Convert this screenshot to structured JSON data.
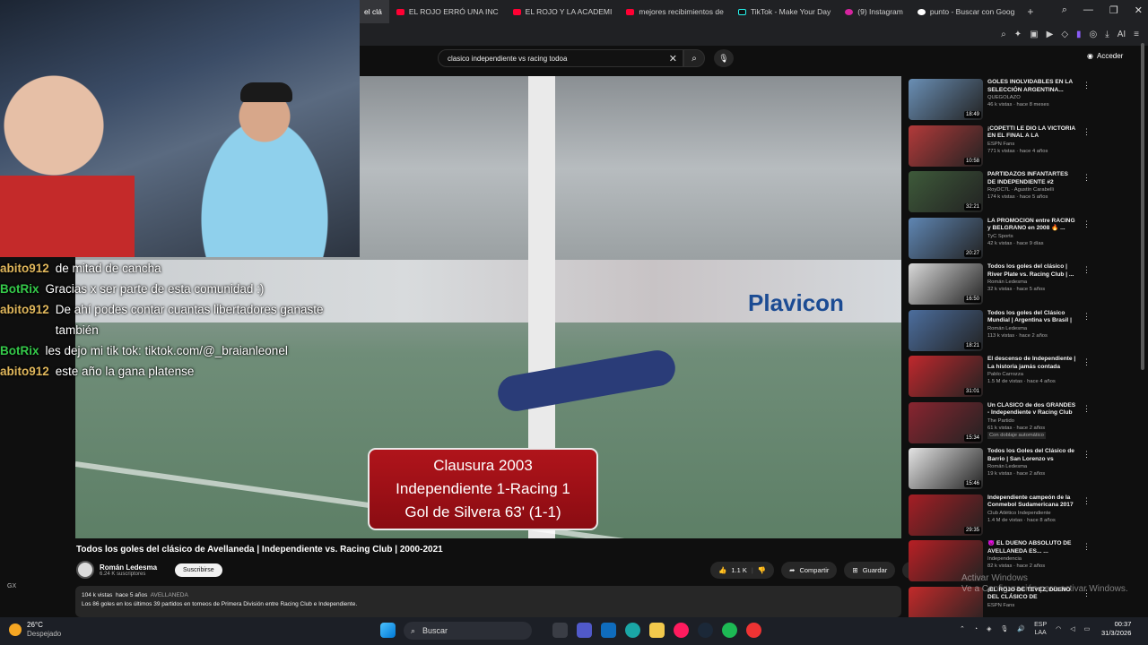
{
  "browser": {
    "tabs": [
      {
        "label": "el clá",
        "active": true
      },
      {
        "label": "EL ROJO ERRÓ UNA INC",
        "active": false
      },
      {
        "label": "EL ROJO Y LA ACADEMI",
        "active": false
      },
      {
        "label": "mejores recibimientos de",
        "active": false
      },
      {
        "label": "TikTok - Make Your Day",
        "active": false
      },
      {
        "label": "(9) Instagram",
        "active": false
      },
      {
        "label": "punto - Buscar con Goog",
        "active": false
      }
    ],
    "toolbar_ai": "AI"
  },
  "youtube": {
    "search_value": "clasico independiente vs racing todoa",
    "signin_label": "Acceder",
    "video": {
      "title": "Todos los goles del clásico de Avellaneda | Independiente vs. Racing Club | 2000-2021",
      "overlay_lines": [
        "Clausura 2003",
        "Independiente 1-Racing 1",
        "Gol de Silvera 63' (1-1)"
      ],
      "banner_text": "Plavicon",
      "channel": "Román Ledesma",
      "subscribers": "6.24 K suscriptores",
      "subscribe_label": "Suscribirse",
      "likes": "1.1 K",
      "share_label": "Compartir",
      "save_label": "Guardar",
      "views": "104 k vistas",
      "age": "hace 5 años",
      "tag": "AVELLANEDA",
      "description": "Los 86 goles en los últimos 39 partidos en torneos de Primera División entre Racing Club e Independiente."
    },
    "recommendations": [
      {
        "title": "GOLES INOLVIDABLES EN LA SELECCIÓN ARGENTINA...",
        "channel": "QUEGOLAZO",
        "meta": "46 k vistas · hace 8 meses",
        "duration": "18:49",
        "color": "#6a8fb5"
      },
      {
        "title": "¡COPETTI LE DIO LA VICTORIA EN EL FINAL A LA ACADEMIA!...",
        "channel": "ESPN Fans",
        "meta": "771 k vistas · hace 4 años",
        "duration": "10:58",
        "color": "#b33a3a"
      },
      {
        "title": "PARTIDAZOS INFANTARTES DE INDEPENDIENTE #2",
        "channel": "RoyDC7L · Agustín Carabelli",
        "meta": "174 k vistas · hace 5 años",
        "duration": "32:21",
        "color": "#3e5a3a"
      },
      {
        "title": "LA PROMOCIÓN entre RACING y BELGRANO en 2008 🔥 ...",
        "channel": "TyC Sports",
        "meta": "42 k vistas · hace 9 días",
        "duration": "20:27",
        "color": "#5f86b3"
      },
      {
        "title": "Todos los goles del clásico | River Plate vs. Racing Club | ...",
        "channel": "Román Ledesma",
        "meta": "32 k vistas · hace 5 años",
        "duration": "16:50",
        "color": "#d9d9d9"
      },
      {
        "title": "Todos los goles del Clásico Mundial | Argentina vs Brasil | ...",
        "channel": "Román Ledesma",
        "meta": "113 k vistas · hace 2 años",
        "duration": "18:21",
        "color": "#4c6e9e"
      },
      {
        "title": "El descenso de Independiente | La historia jamás contada",
        "channel": "Pablo Carrozza",
        "meta": "1.5 M de vistas · hace 4 años",
        "duration": "31:01",
        "color": "#c0282d"
      },
      {
        "title": "Un CLÁSICO de dos GRANDES - Independiente v Racing Club",
        "channel": "The Partido",
        "meta": "61 k vistas · hace 2 años",
        "duration": "15:34",
        "extra": "Con doblaje automático",
        "color": "#8a2530"
      },
      {
        "title": "Todos los Goles del Clásico de Barrio | San Lorenzo vs Huracá...",
        "channel": "Román Ledesma",
        "meta": "19 k vistas · hace 2 años",
        "duration": "15:46",
        "color": "#e4e4e4"
      },
      {
        "title": "Independiente campeón de la Conmebol Sudamericana 2017",
        "channel": "Club Atlético Independiente",
        "meta": "1.4 M de vistas · hace 8 años",
        "duration": "29:35",
        "color": "#a61e24"
      },
      {
        "title": "😈 EL DUEÑO ABSOLUTO DE AVELLANEDA ES... ...",
        "channel": "Independencia",
        "meta": "82 k vistas · hace 2 años",
        "duration": "",
        "color": "#b81f24"
      },
      {
        "title": "¡EL ROJO DE TÉVEZ, DUEÑO DEL CLÁSICO DE AVELLANED...",
        "channel": "ESPN Fans",
        "meta": "",
        "duration": "",
        "color": "#c22a2a"
      }
    ]
  },
  "stream": {
    "chat": [
      {
        "user": "abito912",
        "color": "#e0b75c",
        "msg": "de mitad de cancha"
      },
      {
        "user": "BotRix",
        "color": "#35c94a",
        "msg": "Gracias x ser parte de esta comunidad :)"
      },
      {
        "user": "abito912",
        "color": "#e0b75c",
        "msg": "De ahí podes contar cuantas libertadores ganaste también"
      },
      {
        "user": "BotRix",
        "color": "#35c94a",
        "msg": "les dejo mi tik tok: tiktok.com/@_braianleonel"
      },
      {
        "user": "abito912",
        "color": "#e0b75c",
        "msg": "este año la gana platense"
      }
    ],
    "gx_label": "GX"
  },
  "windows": {
    "watermark": "Activar Windows\nVe a Configuración para activar Windows.",
    "weather_temp": "26°C",
    "weather_desc": "Despejado",
    "search_label": "Buscar",
    "lang_top": "ESP",
    "lang_bottom": "LAA",
    "time": "00:37",
    "date": "31/3/2026"
  }
}
